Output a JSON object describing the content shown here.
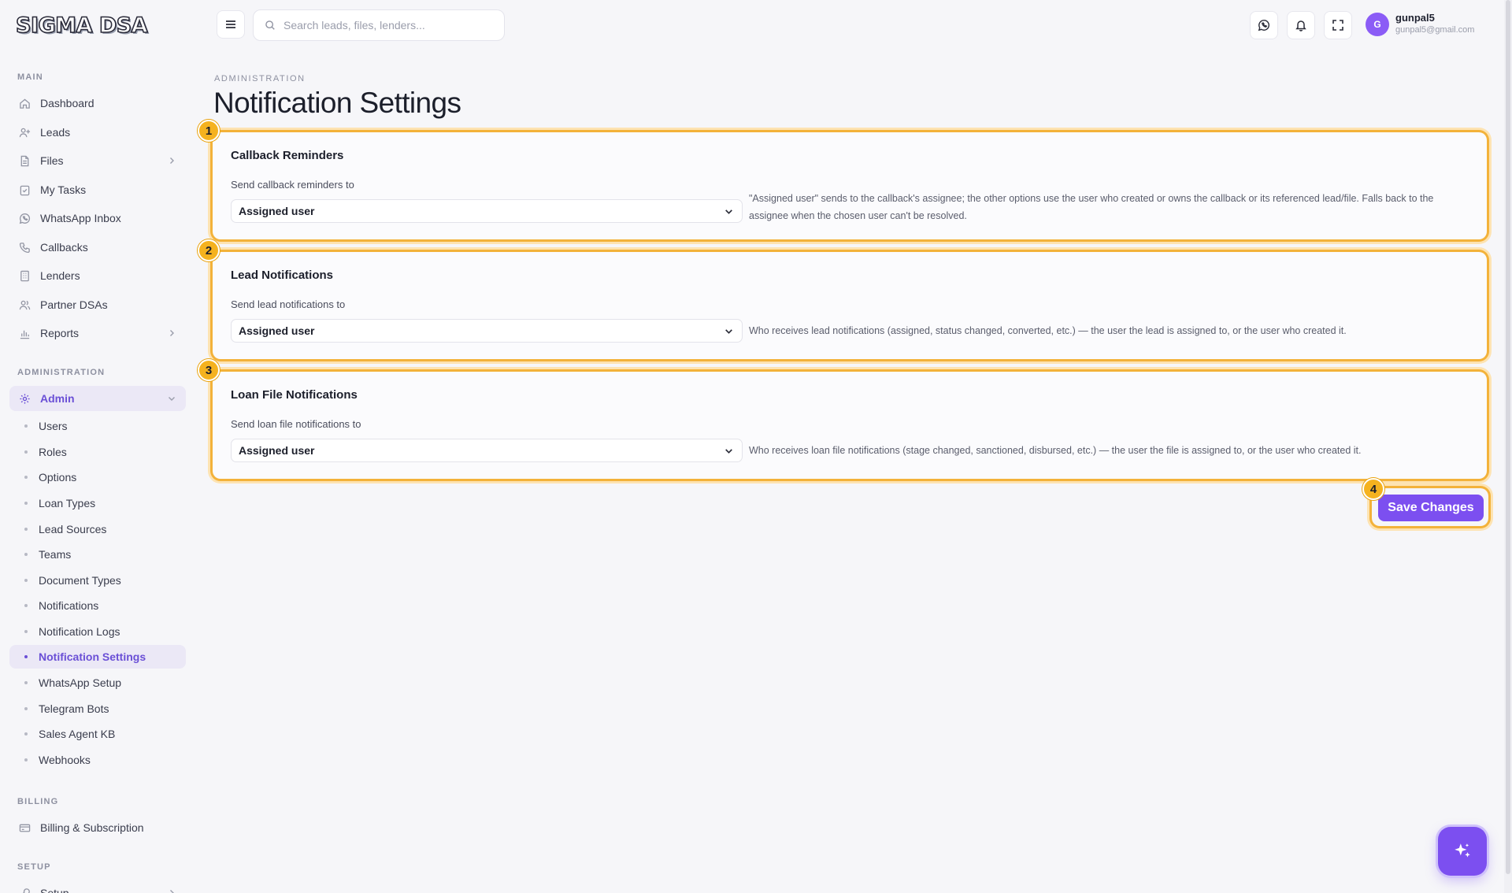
{
  "app": {
    "logo_text": "SIGMA DSA"
  },
  "sidebar": {
    "sections": {
      "main": "MAIN",
      "administration": "ADMINISTRATION",
      "billing": "BILLING",
      "setup": "SETUP"
    },
    "main_items": [
      {
        "label": "Dashboard",
        "icon": "home-icon"
      },
      {
        "label": "Leads",
        "icon": "user-plus-icon"
      },
      {
        "label": "Files",
        "icon": "file-icon"
      },
      {
        "label": "My Tasks",
        "icon": "clipboard-check-icon"
      },
      {
        "label": "WhatsApp Inbox",
        "icon": "whatsapp-icon"
      },
      {
        "label": "Callbacks",
        "icon": "phone-icon"
      },
      {
        "label": "Lenders",
        "icon": "building-icon"
      },
      {
        "label": "Partner DSAs",
        "icon": "users-icon"
      },
      {
        "label": "Reports",
        "icon": "bar-chart-icon"
      }
    ],
    "admin_label": "Admin",
    "admin_sub_items": [
      "Users",
      "Roles",
      "Options",
      "Loan Types",
      "Lead Sources",
      "Teams",
      "Document Types",
      "Notifications",
      "Notification Logs",
      "Notification Settings",
      "WhatsApp Setup",
      "Telegram Bots",
      "Sales Agent KB",
      "Webhooks"
    ],
    "active_sub_item": "Notification Settings",
    "billing_item": "Billing & Subscription",
    "setup_item": "Setup"
  },
  "header": {
    "search_placeholder": "Search leads, files, lenders...",
    "user_initial": "G",
    "user_name": "gunpal5",
    "user_email": "gunpal5@gmail.com"
  },
  "page": {
    "eyebrow": "ADMINISTRATION",
    "title": "Notification Settings",
    "cards": [
      {
        "badge": "1",
        "title": "Callback Reminders",
        "label": "Send callback reminders to",
        "value": "Assigned user",
        "help": "\"Assigned user\" sends to the callback's assignee; the other options use the user who created or owns the callback or its referenced lead/file. Falls back to the assignee when the chosen user can't be resolved."
      },
      {
        "badge": "2",
        "title": "Lead Notifications",
        "label": "Send lead notifications to",
        "value": "Assigned user",
        "help": "Who receives lead notifications (assigned, status changed, converted, etc.) — the user the lead is assigned to, or the user who created it."
      },
      {
        "badge": "3",
        "title": "Loan File Notifications",
        "label": "Send loan file notifications to",
        "value": "Assigned user",
        "help": "Who receives loan file notifications (stage changed, sanctioned, disbursed, etc.) — the user the file is assigned to, or the user who created it."
      }
    ],
    "save_badge": "4",
    "save_label": "Save Changes"
  },
  "colors": {
    "accent": "#7c4ff0",
    "highlight": "#f3b23a",
    "badge": "#f5b21f",
    "active_bg": "#ebe8f6"
  }
}
